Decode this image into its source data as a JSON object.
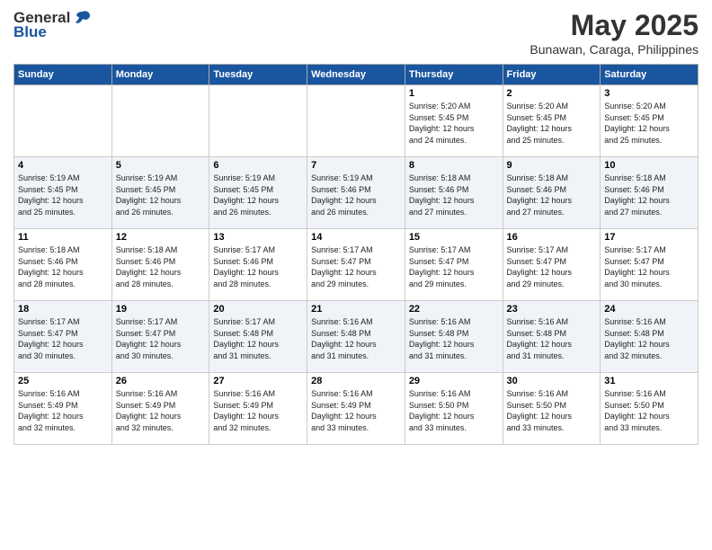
{
  "logo": {
    "general": "General",
    "blue": "Blue"
  },
  "header": {
    "month": "May 2025",
    "location": "Bunawan, Caraga, Philippines"
  },
  "days": [
    "Sunday",
    "Monday",
    "Tuesday",
    "Wednesday",
    "Thursday",
    "Friday",
    "Saturday"
  ],
  "weeks": [
    [
      {
        "day": "",
        "info": ""
      },
      {
        "day": "",
        "info": ""
      },
      {
        "day": "",
        "info": ""
      },
      {
        "day": "",
        "info": ""
      },
      {
        "day": "1",
        "info": "Sunrise: 5:20 AM\nSunset: 5:45 PM\nDaylight: 12 hours\nand 24 minutes."
      },
      {
        "day": "2",
        "info": "Sunrise: 5:20 AM\nSunset: 5:45 PM\nDaylight: 12 hours\nand 25 minutes."
      },
      {
        "day": "3",
        "info": "Sunrise: 5:20 AM\nSunset: 5:45 PM\nDaylight: 12 hours\nand 25 minutes."
      }
    ],
    [
      {
        "day": "4",
        "info": "Sunrise: 5:19 AM\nSunset: 5:45 PM\nDaylight: 12 hours\nand 25 minutes."
      },
      {
        "day": "5",
        "info": "Sunrise: 5:19 AM\nSunset: 5:45 PM\nDaylight: 12 hours\nand 26 minutes."
      },
      {
        "day": "6",
        "info": "Sunrise: 5:19 AM\nSunset: 5:45 PM\nDaylight: 12 hours\nand 26 minutes."
      },
      {
        "day": "7",
        "info": "Sunrise: 5:19 AM\nSunset: 5:46 PM\nDaylight: 12 hours\nand 26 minutes."
      },
      {
        "day": "8",
        "info": "Sunrise: 5:18 AM\nSunset: 5:46 PM\nDaylight: 12 hours\nand 27 minutes."
      },
      {
        "day": "9",
        "info": "Sunrise: 5:18 AM\nSunset: 5:46 PM\nDaylight: 12 hours\nand 27 minutes."
      },
      {
        "day": "10",
        "info": "Sunrise: 5:18 AM\nSunset: 5:46 PM\nDaylight: 12 hours\nand 27 minutes."
      }
    ],
    [
      {
        "day": "11",
        "info": "Sunrise: 5:18 AM\nSunset: 5:46 PM\nDaylight: 12 hours\nand 28 minutes."
      },
      {
        "day": "12",
        "info": "Sunrise: 5:18 AM\nSunset: 5:46 PM\nDaylight: 12 hours\nand 28 minutes."
      },
      {
        "day": "13",
        "info": "Sunrise: 5:17 AM\nSunset: 5:46 PM\nDaylight: 12 hours\nand 28 minutes."
      },
      {
        "day": "14",
        "info": "Sunrise: 5:17 AM\nSunset: 5:47 PM\nDaylight: 12 hours\nand 29 minutes."
      },
      {
        "day": "15",
        "info": "Sunrise: 5:17 AM\nSunset: 5:47 PM\nDaylight: 12 hours\nand 29 minutes."
      },
      {
        "day": "16",
        "info": "Sunrise: 5:17 AM\nSunset: 5:47 PM\nDaylight: 12 hours\nand 29 minutes."
      },
      {
        "day": "17",
        "info": "Sunrise: 5:17 AM\nSunset: 5:47 PM\nDaylight: 12 hours\nand 30 minutes."
      }
    ],
    [
      {
        "day": "18",
        "info": "Sunrise: 5:17 AM\nSunset: 5:47 PM\nDaylight: 12 hours\nand 30 minutes."
      },
      {
        "day": "19",
        "info": "Sunrise: 5:17 AM\nSunset: 5:47 PM\nDaylight: 12 hours\nand 30 minutes."
      },
      {
        "day": "20",
        "info": "Sunrise: 5:17 AM\nSunset: 5:48 PM\nDaylight: 12 hours\nand 31 minutes."
      },
      {
        "day": "21",
        "info": "Sunrise: 5:16 AM\nSunset: 5:48 PM\nDaylight: 12 hours\nand 31 minutes."
      },
      {
        "day": "22",
        "info": "Sunrise: 5:16 AM\nSunset: 5:48 PM\nDaylight: 12 hours\nand 31 minutes."
      },
      {
        "day": "23",
        "info": "Sunrise: 5:16 AM\nSunset: 5:48 PM\nDaylight: 12 hours\nand 31 minutes."
      },
      {
        "day": "24",
        "info": "Sunrise: 5:16 AM\nSunset: 5:48 PM\nDaylight: 12 hours\nand 32 minutes."
      }
    ],
    [
      {
        "day": "25",
        "info": "Sunrise: 5:16 AM\nSunset: 5:49 PM\nDaylight: 12 hours\nand 32 minutes."
      },
      {
        "day": "26",
        "info": "Sunrise: 5:16 AM\nSunset: 5:49 PM\nDaylight: 12 hours\nand 32 minutes."
      },
      {
        "day": "27",
        "info": "Sunrise: 5:16 AM\nSunset: 5:49 PM\nDaylight: 12 hours\nand 32 minutes."
      },
      {
        "day": "28",
        "info": "Sunrise: 5:16 AM\nSunset: 5:49 PM\nDaylight: 12 hours\nand 33 minutes."
      },
      {
        "day": "29",
        "info": "Sunrise: 5:16 AM\nSunset: 5:50 PM\nDaylight: 12 hours\nand 33 minutes."
      },
      {
        "day": "30",
        "info": "Sunrise: 5:16 AM\nSunset: 5:50 PM\nDaylight: 12 hours\nand 33 minutes."
      },
      {
        "day": "31",
        "info": "Sunrise: 5:16 AM\nSunset: 5:50 PM\nDaylight: 12 hours\nand 33 minutes."
      }
    ]
  ]
}
